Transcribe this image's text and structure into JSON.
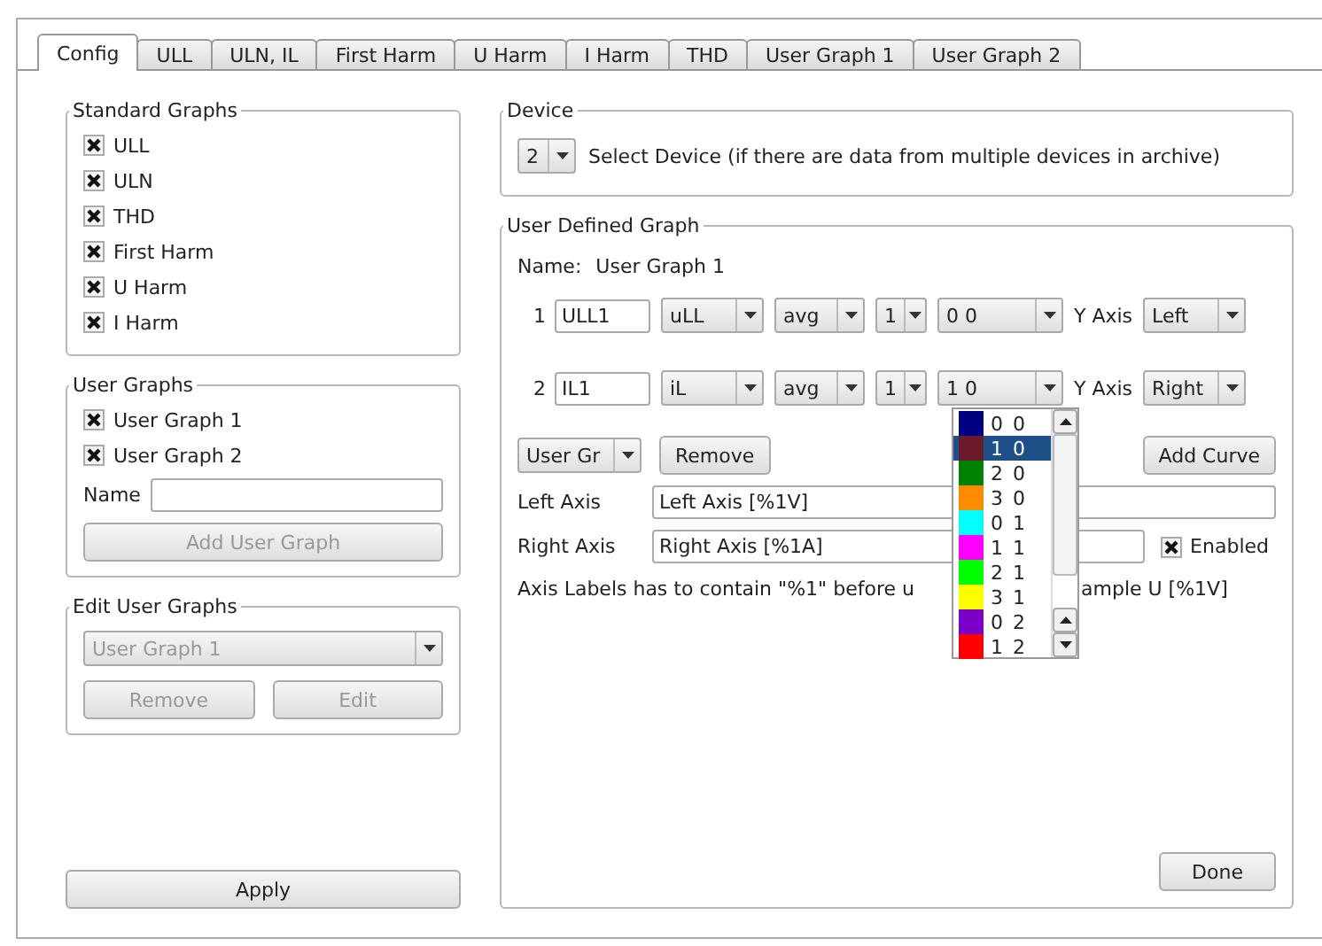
{
  "tabs": [
    {
      "label": "Config",
      "selected": true
    },
    {
      "label": "ULL",
      "selected": false
    },
    {
      "label": "ULN, IL",
      "selected": false
    },
    {
      "label": "First Harm",
      "selected": false
    },
    {
      "label": "U Harm",
      "selected": false
    },
    {
      "label": "I Harm",
      "selected": false
    },
    {
      "label": "THD",
      "selected": false
    },
    {
      "label": "User Graph 1",
      "selected": false
    },
    {
      "label": "User Graph 2",
      "selected": false
    }
  ],
  "standard_graphs": {
    "title": "Standard Graphs",
    "items": [
      {
        "label": "ULL",
        "checked": true
      },
      {
        "label": "ULN",
        "checked": true
      },
      {
        "label": "THD",
        "checked": true
      },
      {
        "label": "First Harm",
        "checked": true
      },
      {
        "label": "U Harm",
        "checked": true
      },
      {
        "label": "I Harm",
        "checked": true
      }
    ]
  },
  "user_graphs": {
    "title": "User Graphs",
    "items": [
      {
        "label": "User Graph 1",
        "checked": true
      },
      {
        "label": "User Graph 2",
        "checked": true
      }
    ],
    "name_label": "Name",
    "add_button": {
      "label": "Add User Graph",
      "disabled": true
    }
  },
  "edit_user_graphs": {
    "title": "Edit User Graphs",
    "combo": {
      "value": "User Graph 1",
      "disabled": true
    },
    "buttons": [
      {
        "label": "Remove",
        "disabled": true
      },
      {
        "label": "Edit",
        "disabled": true
      }
    ]
  },
  "apply_button": "Apply",
  "device": {
    "title": "Device",
    "value": "2",
    "description": "Select Device (if there are data from multiple devices in archive)"
  },
  "user_defined_graph": {
    "title": "User Defined Graph",
    "name_label": "Name:",
    "name": "User Graph 1",
    "curves": [
      {
        "index": "1",
        "name": "ULL1",
        "quantity": "uLL",
        "function": "avg",
        "phase": "1",
        "color_code": "0 0",
        "y_axis_label": "Y Axis",
        "y_axis": "Left"
      },
      {
        "index": "2",
        "name": "IL1",
        "quantity": "iL",
        "function": "avg",
        "phase": "1",
        "color_code": "1 0",
        "y_axis_label": "Y Axis",
        "y_axis": "Right"
      }
    ],
    "graph_combo": "User Gr",
    "remove_button": "Remove",
    "add_curve_button": "Add Curve",
    "left_axis": {
      "label": "Left Axis",
      "value": "Left Axis [%1V]"
    },
    "right_axis": {
      "label": "Right Axis",
      "value": "Right Axis [%1A]"
    },
    "enabled": {
      "label": "Enabled",
      "checked": true
    },
    "hint_parts": [
      "Axis Labels has to contain \"%1\" before u",
      "ample U [%1V]"
    ],
    "done_button": "Done"
  },
  "color_dropdown": {
    "items": [
      {
        "label": "0 0",
        "color": "#000080",
        "selected": false
      },
      {
        "label": "1 0",
        "color": "#6b1a2a",
        "selected": true
      },
      {
        "label": "2 0",
        "color": "#008000",
        "selected": false
      },
      {
        "label": "3 0",
        "color": "#ff8c00",
        "selected": false
      },
      {
        "label": "0 1",
        "color": "#00ffff",
        "selected": false
      },
      {
        "label": "1 1",
        "color": "#ff00ff",
        "selected": false
      },
      {
        "label": "2 1",
        "color": "#00ff00",
        "selected": false
      },
      {
        "label": "3 1",
        "color": "#ffff00",
        "selected": false
      },
      {
        "label": "0 2",
        "color": "#7b00c8",
        "selected": false
      },
      {
        "label": "1 2",
        "color": "#ff0000",
        "selected": false
      }
    ]
  }
}
